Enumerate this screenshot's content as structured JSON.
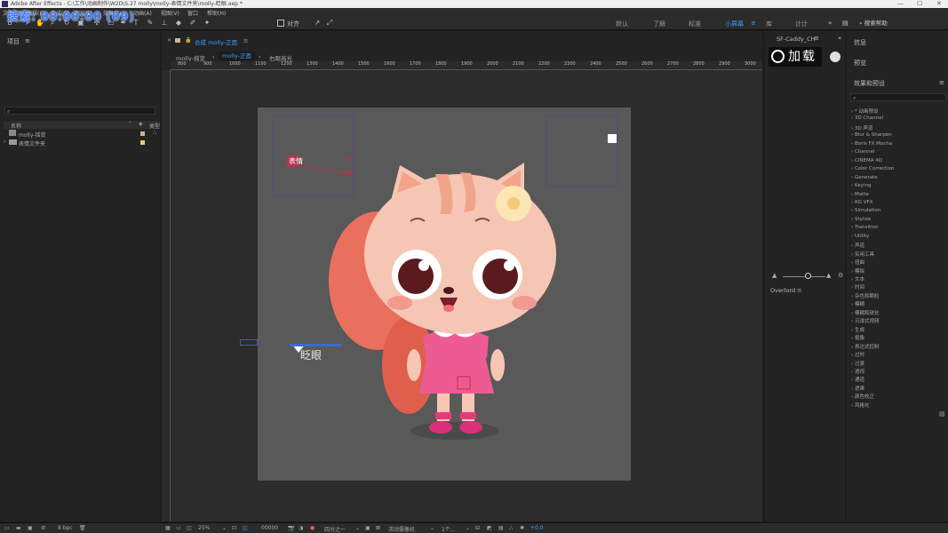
{
  "window": {
    "title": "Adobe After Effects - C:\\工作\\动画制作\\W2D\\S.27 molly\\molly-表情文件夹\\molly-眨眼.aep *",
    "controls": [
      "—",
      "☐",
      "✕"
    ]
  },
  "overlay_timecode": "搜索: 00:00:00 (09)",
  "menubar": {
    "items": [
      "文件(F)",
      "编辑(E)",
      "合成(C)",
      "图层(L)",
      "效果(T)",
      "动画(A)",
      "视图(V)",
      "窗口",
      "帮助(H)"
    ]
  },
  "toolbar": {
    "align_label": "对齐",
    "workspaces": [
      "默认",
      "了解",
      "标准",
      "小屏幕",
      "库",
      "计计"
    ],
    "active_workspace": "小屏幕",
    "search_placeholder": "搜索帮助"
  },
  "project": {
    "title": "项目",
    "columns": [
      "名称",
      "类型"
    ],
    "rows": [
      {
        "name": "molly-摇变",
        "color": "#c8b58e"
      },
      {
        "name": "表情文件夹",
        "color": "#e3d15a"
      }
    ]
  },
  "comp": {
    "tab_title": "合成 molly-正面",
    "flow": [
      "molly-摇变",
      "molly-正面",
      "右眼高光"
    ],
    "active_flow": "molly-正面",
    "ruler_ticks": [
      "800",
      "900",
      "1000",
      "1100",
      "1200",
      "1300",
      "1400",
      "1500",
      "1600",
      "1700",
      "1800",
      "1900",
      "2000",
      "2100",
      "2200",
      "2300",
      "2400",
      "2500",
      "2600",
      "2700",
      "2800",
      "2900",
      "3000"
    ],
    "labels": {
      "blink": "眨眼",
      "control_tag": "表情"
    }
  },
  "caddy": {
    "tab_title": "SF-Caddy_CH",
    "load_label": "加载",
    "overlord_title": "Overlord"
  },
  "right_panel": {
    "info_title": "信息",
    "preview_title": "预览",
    "effects_title": "效果和预设",
    "effects": [
      "* 动画预设",
      "3D Channel",
      "3D 声道",
      "Blur & Sharpen",
      "Boris FX Mocha",
      "Channel",
      "CINEMA 4D",
      "Color Correction",
      "Generate",
      "Keying",
      "Matte",
      "RG VFX",
      "Simulation",
      "Stylize",
      "Transition",
      "Utility",
      "声道",
      "实用工具",
      "扭曲",
      "模拟",
      "文本",
      "时间",
      "杂色和颗粒",
      "模糊",
      "模糊和锐化",
      "沉浸式视频",
      "生成",
      "抠像",
      "表达式控制",
      "过时",
      "过渡",
      "透视",
      "通道",
      "遮罩",
      "颜色校正",
      "风格化"
    ]
  },
  "bottombar": {
    "bpc": "8 bpc",
    "zoom": "25%",
    "timecode": "00000",
    "resolution": "四分之一",
    "camera": "活动摄像机",
    "views": "1个...",
    "exposure": "+0.0"
  },
  "colors": {
    "accent": "#3b9cff",
    "canvas": "#595959",
    "skin": "#f6c6b4",
    "dress": "#ee5b93",
    "ear_hair": "#e9705e"
  }
}
